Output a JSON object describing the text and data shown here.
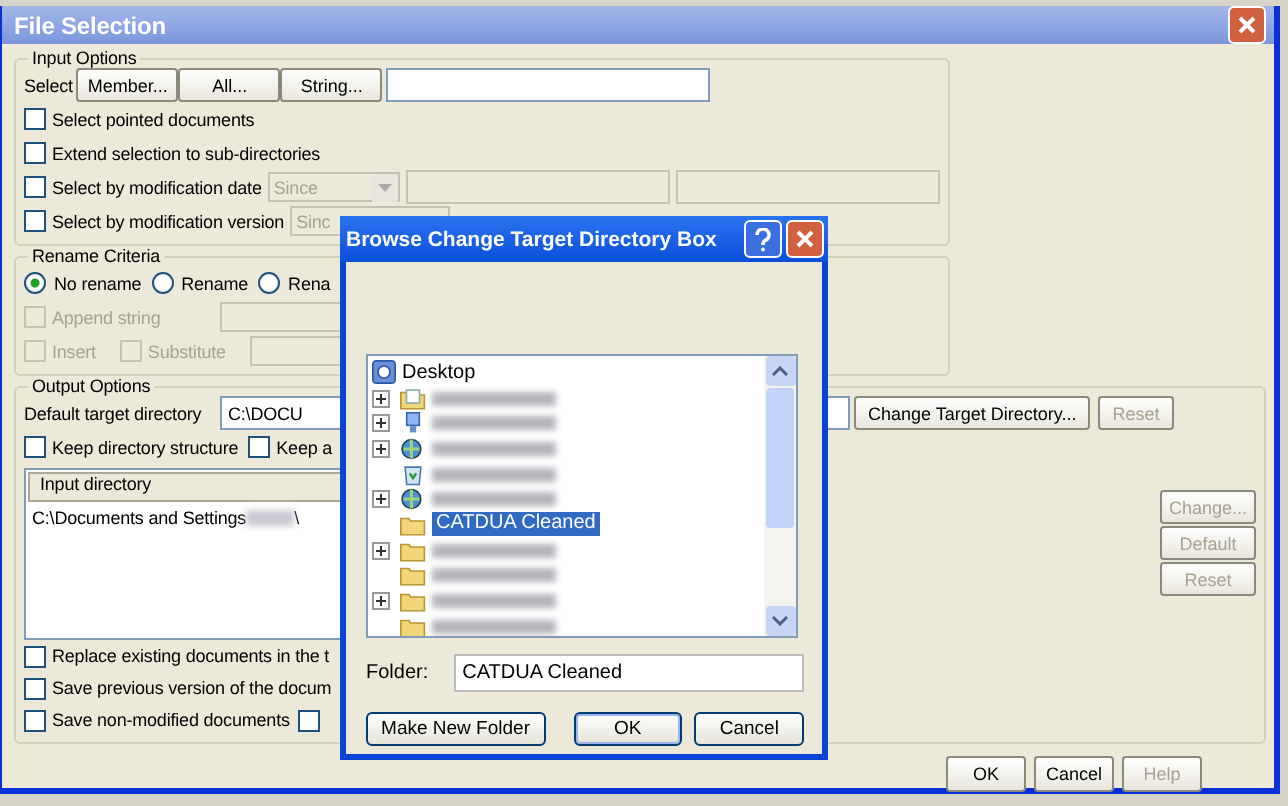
{
  "window": {
    "title": "File Selection"
  },
  "input_options": {
    "legend": "Input Options",
    "select_label": "Select",
    "select_buttons": [
      {
        "label": "Member..."
      },
      {
        "label": "All..."
      },
      {
        "label": "String..."
      }
    ],
    "rows": [
      {
        "kind": "plain",
        "label": "Select pointed documents",
        "checked": false
      },
      {
        "kind": "plain",
        "label": "Extend selection to sub-directories",
        "checked": false
      },
      {
        "kind": "date",
        "label": "Select by modification date",
        "checked": false,
        "dropdown": "Since",
        "disabled": true
      },
      {
        "kind": "version",
        "label": "Select by modification version",
        "checked": false,
        "dropdown": "Sinc",
        "disabled": true
      }
    ]
  },
  "rename_criteria": {
    "legend": "Rename Criteria",
    "radios": [
      {
        "label": "No rename",
        "selected": true
      },
      {
        "label": "Rename",
        "selected": false
      },
      {
        "label": "Rena",
        "selected": false
      }
    ],
    "checkboxes": [
      {
        "label": "Append string",
        "checked": false,
        "disabled": true
      },
      {
        "label": "Insert",
        "checked": false,
        "disabled": true
      },
      {
        "label": "Substitute",
        "checked": false,
        "disabled": true
      }
    ]
  },
  "output_options": {
    "legend": "Output Options",
    "target_label": "Default target directory",
    "target_value": "C:\\DOCU",
    "target_buttons": [
      {
        "label": "Change Target Directory...",
        "disabled": false
      },
      {
        "label": "Reset",
        "disabled": true
      }
    ],
    "keep": [
      {
        "label": "Keep directory structure",
        "checked": false
      },
      {
        "label": "Keep a",
        "checked": false
      }
    ],
    "table": {
      "columns": [
        "Input directory"
      ],
      "rows": [
        {
          "path_start": "C:\\Documents and Settings",
          "path_end": "\\"
        }
      ]
    },
    "side_buttons": [
      {
        "label": "Change...",
        "disabled": true
      },
      {
        "label": "Default",
        "disabled": true
      },
      {
        "label": "Reset",
        "disabled": true
      }
    ],
    "options": [
      {
        "label": "Replace existing documents in the t",
        "checked": false
      },
      {
        "label": "Save previous version of the docum",
        "checked": false
      },
      {
        "label": "Save non-modified documents",
        "checked": false,
        "extra_checkbox": {
          "checked": false
        }
      }
    ]
  },
  "buttons": [
    {
      "label": "OK",
      "disabled": false
    },
    {
      "label": "Cancel",
      "disabled": false
    },
    {
      "label": "Help",
      "disabled": true
    }
  ],
  "dialog": {
    "title": "Browse Change Target Directory Box",
    "tree": {
      "label": "Desktop",
      "kind": "desktop",
      "children": [
        {
          "kind": "documents",
          "expandable": true,
          "selected": false
        },
        {
          "kind": "computer",
          "expandable": true,
          "selected": false
        },
        {
          "kind": "network",
          "expandable": true,
          "selected": false
        },
        {
          "kind": "recycle",
          "expandable": false,
          "selected": false
        },
        {
          "kind": "network",
          "expandable": true,
          "selected": false
        },
        {
          "kind": "folder",
          "label": "CATDUA Cleaned",
          "expandable": false,
          "selected": true
        },
        {
          "kind": "folder",
          "expandable": true,
          "selected": false
        },
        {
          "kind": "folder",
          "expandable": false,
          "selected": false
        },
        {
          "kind": "folder",
          "expandable": true,
          "selected": false
        },
        {
          "kind": "folder",
          "expandable": false,
          "selected": false
        }
      ]
    },
    "folder_label": "Folder:",
    "folder_value": "CATDUA Cleaned",
    "buttons": [
      {
        "label": "Make New Folder",
        "kind": "wide"
      },
      {
        "label": "OK",
        "kind": "default"
      },
      {
        "label": "Cancel",
        "kind": "normal"
      }
    ]
  }
}
